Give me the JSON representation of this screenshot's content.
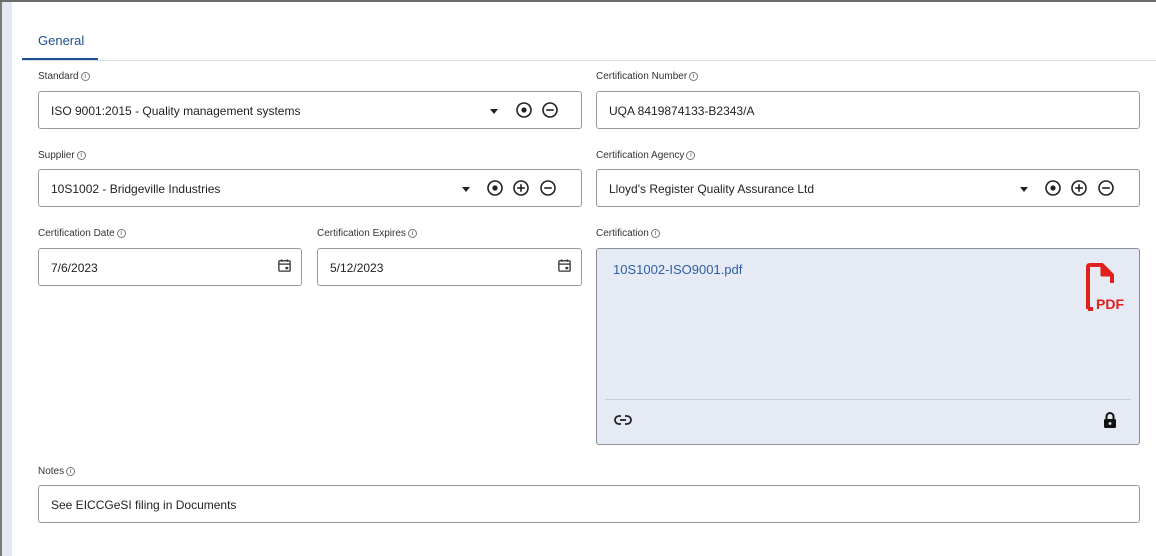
{
  "tabs": [
    {
      "label": "General",
      "active": true
    }
  ],
  "info_glyph": "ⓘ",
  "fields": {
    "standard": {
      "label": "Standard",
      "value": "ISO 9001:2015 - Quality management systems"
    },
    "cert_number": {
      "label": "Certification Number",
      "value": "UQA 8419874133-B2343/A"
    },
    "supplier": {
      "label": "Supplier",
      "value": "10S1002 - Bridgeville Industries"
    },
    "agency": {
      "label": "Certification Agency",
      "value": "Lloyd's Register Quality Assurance Ltd"
    },
    "cert_date": {
      "label": "Certification Date",
      "value": "7/6/2023"
    },
    "cert_expires": {
      "label": "Certification Expires",
      "value": "5/12/2023"
    },
    "certification": {
      "label": "Certification",
      "file_name": "10S1002-ISO9001.pdf",
      "file_badge": "PDF"
    },
    "notes": {
      "label": "Notes",
      "value": "See EICCGeSI filing in Documents"
    }
  },
  "icons": {
    "dropdown": "caret-down-icon",
    "select": "target-icon",
    "add": "plus-circle-icon",
    "remove": "minus-circle-icon",
    "calendar": "calendar-icon",
    "pdf": "pdf-file-icon",
    "link": "link-icon",
    "lock": "lock-icon"
  },
  "colors": {
    "accent": "#1f4f8f",
    "link": "#2a5fa8",
    "pdf_red": "#e0201b",
    "attachment_bg": "#e6eaf4"
  }
}
